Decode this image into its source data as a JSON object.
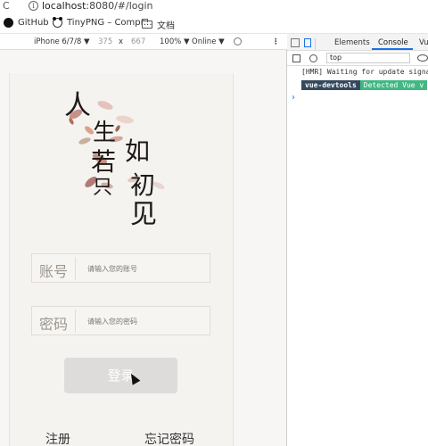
{
  "browser": {
    "url_host": "localhost",
    "url_path": ":8080/#/login"
  },
  "bookmarks": [
    {
      "label": "GitHub"
    },
    {
      "label": "TinyPNG – Compr..."
    },
    {
      "label": "文档"
    }
  ],
  "device_toolbar": {
    "device": "iPhone 6/7/8 ▼",
    "width": "375",
    "times": "x",
    "height": "667",
    "zoom": "100% ▼",
    "network": "Online ▼"
  },
  "devtools": {
    "tabs": [
      "Elements",
      "Console",
      "Vue"
    ],
    "context": "top",
    "log_hmr": "[HMR] Waiting for update signal",
    "vue_badge": "vue-devtools",
    "vue_detected": "Detected Vue v",
    "prompt": "›"
  },
  "page": {
    "art_chars": [
      "人",
      "生",
      "若",
      "只",
      "如",
      "初",
      "见"
    ],
    "account_label": "账号",
    "account_placeholder": "请输入您的账号",
    "password_label": "密码",
    "password_placeholder": "请输入您的密码",
    "login_button": "登录",
    "register_link": "注册",
    "forgot_link": "忘记密码"
  },
  "colors": {
    "vue_dark": "#35495e",
    "vue_green": "#41b883",
    "devtools_accent": "#1a73e8"
  }
}
